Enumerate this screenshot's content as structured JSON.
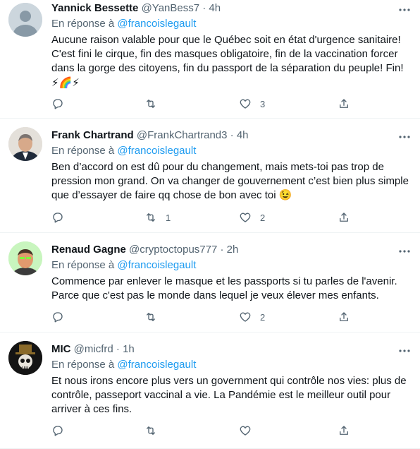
{
  "reply_prefix": "En réponse à",
  "tweets": [
    {
      "name": "Yannick Bessette",
      "handle": "@YanBess7",
      "dot": "·",
      "time": "4h",
      "reply_to": "@francoislegault",
      "text_lines": [
        "Aucune raison valable pour que le Québec soit en état d'urgence sanitaire!",
        "C'est fini le cirque, fin des masques obligatoire, fin de la vaccination forcer",
        "dans la gorge des citoyens, fin du passport de la séparation du peuple! Fin!",
        "⚡🌈⚡"
      ],
      "replies": "",
      "retweets": "",
      "likes": "3"
    },
    {
      "name": "Frank Chartrand",
      "handle": "@FrankChartrand3",
      "dot": "·",
      "time": "4h",
      "reply_to": "@francoislegault",
      "text_lines": [
        "Ben d’accord on est dû pour du changement, mais mets-toi pas trop de",
        "pression mon grand. On va changer de gouvernement c’est bien plus simple",
        "que d’essayer de faire qq chose de bon avec toi 😉"
      ],
      "replies": "",
      "retweets": "1",
      "likes": "2"
    },
    {
      "name": "Renaud Gagne",
      "handle": "@cryptoctopus777",
      "dot": "·",
      "time": "2h",
      "reply_to": "@francoislegault",
      "text_lines": [
        "Commence par enlever le masque et les passports si tu parles de l'avenir.",
        "Parce que c'est pas le monde dans lequel je veux élever mes enfants."
      ],
      "replies": "",
      "retweets": "",
      "likes": "2"
    },
    {
      "name": "MIC",
      "handle": "@micfrd",
      "dot": "·",
      "time": "1h",
      "reply_to": "@francoislegault",
      "text_lines": [
        "Et nous irons encore plus vers un government qui contrôle nos vies: plus de",
        "contrôle, passeport vaccinal a vie. La Pandémie est le meilleur outil pour",
        "arriver à ces fins."
      ],
      "replies": "",
      "retweets": "",
      "likes": ""
    }
  ],
  "icons": {
    "more": "more-horizontal-icon",
    "reply": "reply-icon",
    "retweet": "retweet-icon",
    "like": "heart-icon",
    "share": "share-icon"
  },
  "colors": {
    "text": "#0f1419",
    "secondary": "#536471",
    "link": "#1d9bf0",
    "divider": "#eff3f4"
  }
}
